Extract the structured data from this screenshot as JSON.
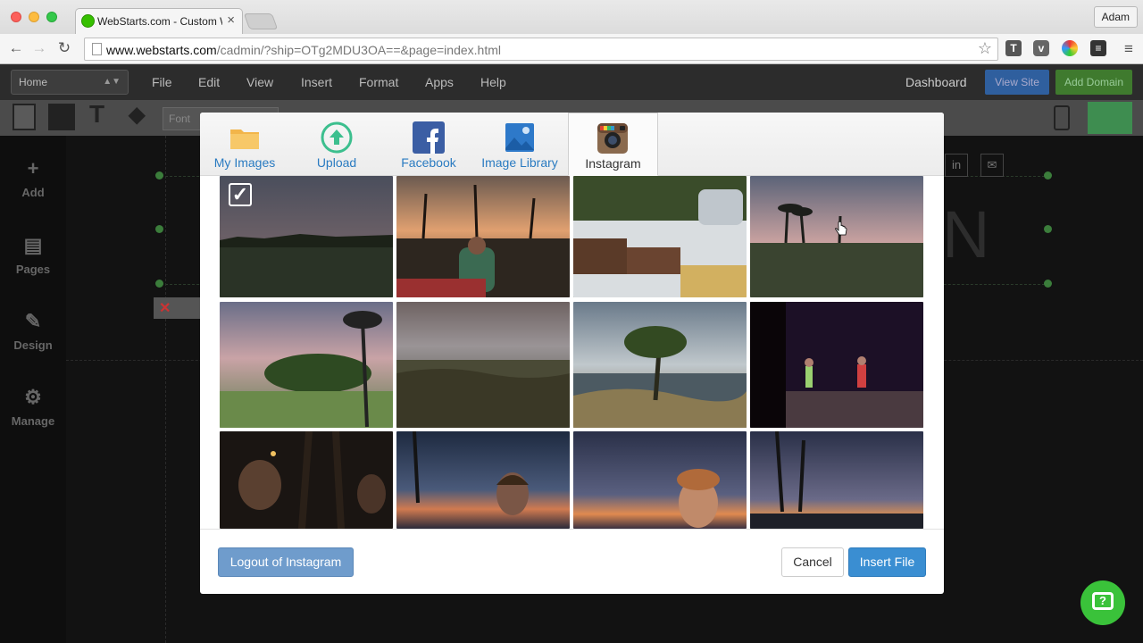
{
  "browser": {
    "tab_title": "WebStarts.com - Custom W",
    "tab_close": "×",
    "profile": "Adam",
    "url_host": "www.webstarts.com",
    "url_path": "/cadmin/?ship=OTg2MDU3OA==&page=index.html",
    "back": "←",
    "forward": "→",
    "reload": "↻",
    "star": "☆"
  },
  "editor": {
    "page_select": "Home",
    "menu": [
      "File",
      "Edit",
      "View",
      "Insert",
      "Format",
      "Apps",
      "Help"
    ],
    "dashboard": "Dashboard",
    "view_site": "View Site",
    "add_domain": "Add Domain",
    "font_label": "Font",
    "sidebar": [
      {
        "label": "Add",
        "icon": "+"
      },
      {
        "label": "Pages",
        "icon": "▤"
      },
      {
        "label": "Design",
        "icon": "✎"
      },
      {
        "label": "Manage",
        "icon": "⚙"
      }
    ]
  },
  "modal": {
    "tabs": [
      {
        "label": "My Images",
        "icon": "folder-icon"
      },
      {
        "label": "Upload",
        "icon": "upload-icon"
      },
      {
        "label": "Facebook",
        "icon": "facebook-icon"
      },
      {
        "label": "Image Library",
        "icon": "image-library-icon"
      },
      {
        "label": "Instagram",
        "icon": "instagram-icon",
        "active": true
      }
    ],
    "photos": [
      {
        "subject": "dusk over palm shoreline",
        "selected": true
      },
      {
        "subject": "outdoor dinner at sunset"
      },
      {
        "subject": "dessert buffet table"
      },
      {
        "subject": "palm trees at sunset"
      },
      {
        "subject": "palm and shrubs at dusk"
      },
      {
        "subject": "grassy coast at dusk"
      },
      {
        "subject": "lone tree by the sea"
      },
      {
        "subject": "two people on beach at night"
      },
      {
        "subject": "evening portraits"
      },
      {
        "subject": "portrait at sunset"
      },
      {
        "subject": "curly-haired portrait at sunset"
      },
      {
        "subject": "palm silhouette sunset"
      }
    ],
    "logout_label": "Logout of Instagram",
    "cancel_label": "Cancel",
    "insert_label": "Insert File",
    "check_mark": "✓"
  },
  "chat": {
    "label": "?"
  }
}
